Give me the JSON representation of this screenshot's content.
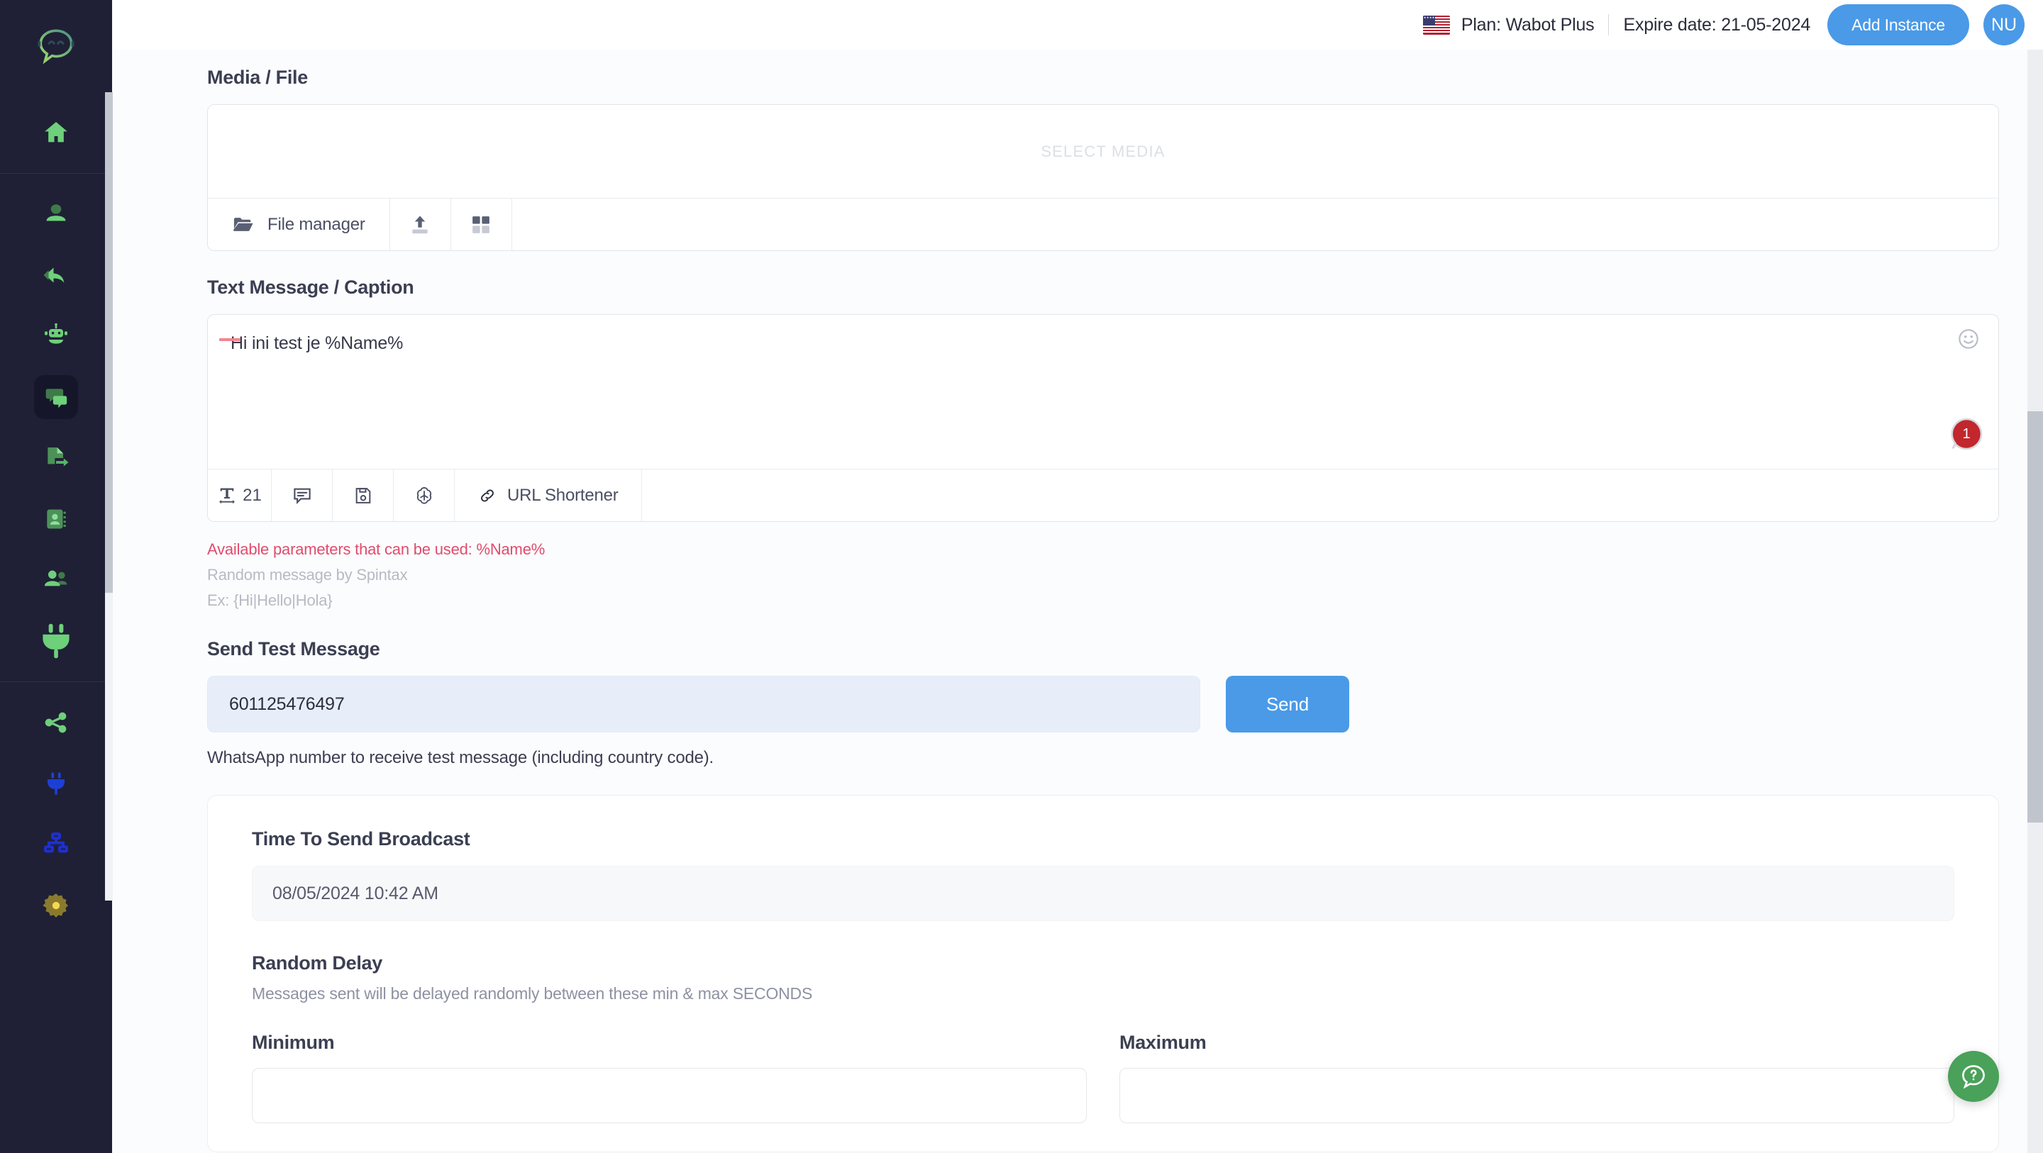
{
  "header": {
    "flag_icon": "us-flag-icon",
    "plan_text": "Plan: Wabot Plus",
    "expire_text": "Expire date: 21-05-2024",
    "add_instance_label": "Add Instance",
    "avatar_initials": "NU",
    "accent_color": "#4a9ae8"
  },
  "sidebar": {
    "logo_icon": "chat-bubble-logo-icon",
    "background": "#1f2035",
    "groups": [
      {
        "items": [
          {
            "icon": "home-icon",
            "name": "sidebar-item-home",
            "active": false,
            "color": "#6ed07a"
          }
        ]
      },
      {
        "items": [
          {
            "icon": "user-icon",
            "name": "sidebar-item-profile",
            "active": false,
            "color": "#6ed07a"
          },
          {
            "icon": "reply-icon",
            "name": "sidebar-item-auto-reply",
            "active": false,
            "color": "#6ed07a"
          },
          {
            "icon": "robot-icon",
            "name": "sidebar-item-chatbot",
            "active": false,
            "color": "#6ed07a"
          },
          {
            "icon": "chats-icon",
            "name": "sidebar-item-broadcast",
            "active": true,
            "color": "#6ed07a"
          },
          {
            "icon": "file-export-icon",
            "name": "sidebar-item-export",
            "active": false,
            "color": "#57a862"
          },
          {
            "icon": "contact-book-icon",
            "name": "sidebar-item-contacts",
            "active": false,
            "color": "#57a862"
          },
          {
            "icon": "group-users-icon",
            "name": "sidebar-item-groups",
            "active": false,
            "color": "#6ed07a"
          },
          {
            "icon": "plug-icon",
            "name": "sidebar-item-integrations",
            "active": false,
            "color": "#6ed07a"
          }
        ]
      },
      {
        "items": [
          {
            "icon": "share-nodes-icon",
            "name": "sidebar-item-share",
            "active": false,
            "color": "#6ed07a"
          },
          {
            "icon": "plug-blue-icon",
            "name": "sidebar-item-api",
            "active": false,
            "color": "#1e3fd6"
          },
          {
            "icon": "sitemap-icon",
            "name": "sidebar-item-sitemap",
            "active": false,
            "color": "#1e2fd0"
          },
          {
            "icon": "gear-icon",
            "name": "sidebar-item-settings",
            "active": false,
            "color": "#8a7a2e"
          }
        ]
      }
    ]
  },
  "media": {
    "title": "Media / File",
    "placeholder": "SELECT MEDIA",
    "file_manager_label": "File manager",
    "file_manager_icon": "folder-open-icon",
    "upload_icon": "upload-icon",
    "grid_icon": "grid-icon"
  },
  "message": {
    "title": "Text Message / Caption",
    "value": "Hi ini test je %Name%",
    "emoji_icon": "emoji-smiley-icon",
    "badge_count": "1",
    "badge_color": "#c1272d",
    "toolbar": {
      "char_count": "21",
      "char_count_icon": "text-width-icon",
      "comment_icon": "message-box-icon",
      "save_icon": "floppy-save-icon",
      "ai_icon": "openai-icon",
      "url_shortener_icon": "link-icon",
      "url_shortener_label": "URL Shortener"
    },
    "hint_params": "Available parameters that can be used: %Name%",
    "hint_spintax": "Random message by Spintax",
    "hint_example": "Ex: {Hi|Hello|Hola}",
    "hint_params_color": "#e04c6d"
  },
  "send_test": {
    "title": "Send Test Message",
    "number_value": "601125476497",
    "number_placeholder": "",
    "send_label": "Send",
    "note": "WhatsApp number to receive test message (including country code)."
  },
  "broadcast": {
    "time_title": "Time To Send Broadcast",
    "time_value": "08/05/2024 10:42 AM",
    "delay_title": "Random Delay",
    "delay_note": "Messages sent will be delayed randomly between these min & max SECONDS",
    "minimum_label": "Minimum",
    "minimum_value": "",
    "maximum_label": "Maximum",
    "maximum_value": ""
  },
  "help": {
    "icon": "help-chat-icon",
    "color": "#4aa159"
  }
}
